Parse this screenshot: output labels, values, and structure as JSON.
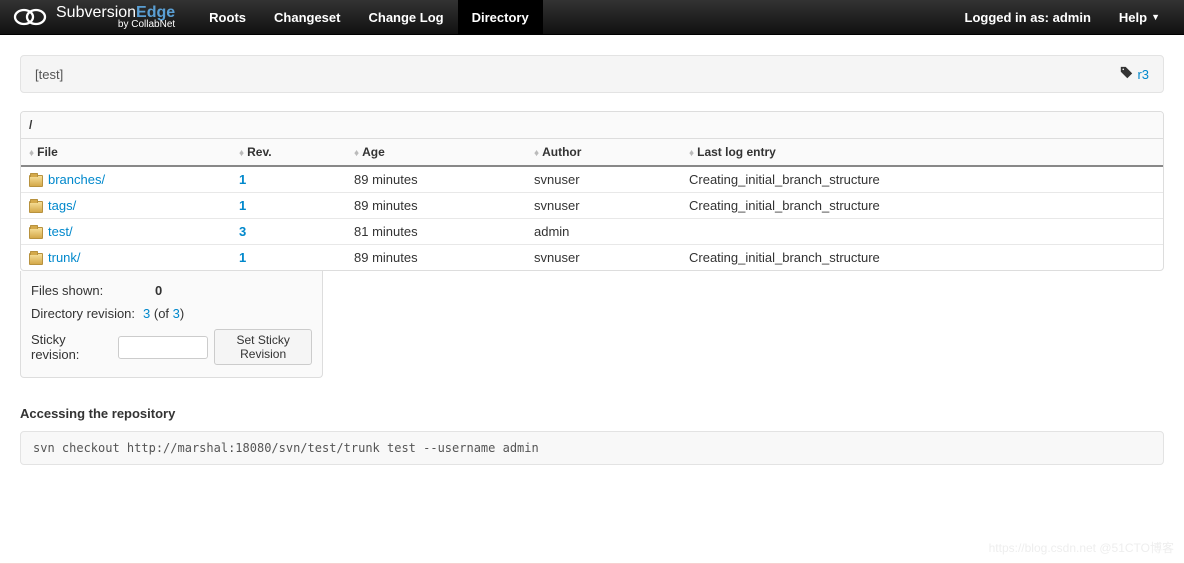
{
  "brand": {
    "subversion": "Subversion",
    "edge": "Edge",
    "sub": "by CollabNet"
  },
  "nav": {
    "roots": "Roots",
    "changeset": "Changeset",
    "changelog": "Change Log",
    "directory": "Directory"
  },
  "nav_right": {
    "logged_in": "Logged in as: admin",
    "help": "Help"
  },
  "breadcrumb": {
    "path": "[test]",
    "rev": "r3"
  },
  "table": {
    "root_path": "/",
    "headers": {
      "file": "File",
      "rev": "Rev.",
      "age": "Age",
      "author": "Author",
      "log": "Last log entry"
    },
    "rows": [
      {
        "name": "branches/",
        "rev": "1",
        "age": "89 minutes",
        "author": "svnuser",
        "log": "Creating_initial_branch_structure"
      },
      {
        "name": "tags/",
        "rev": "1",
        "age": "89 minutes",
        "author": "svnuser",
        "log": "Creating_initial_branch_structure"
      },
      {
        "name": "test/",
        "rev": "3",
        "age": "81 minutes",
        "author": "admin",
        "log": ""
      },
      {
        "name": "trunk/",
        "rev": "1",
        "age": "89 minutes",
        "author": "svnuser",
        "log": "Creating_initial_branch_structure"
      }
    ]
  },
  "info": {
    "files_shown_label": "Files shown:",
    "files_shown_value": "0",
    "dir_rev_label": "Directory revision:",
    "dir_rev_value": "3",
    "dir_rev_of": " (of ",
    "dir_rev_total": "3",
    "dir_rev_close": ")",
    "sticky_label": "Sticky revision:",
    "sticky_button": "Set Sticky Revision"
  },
  "access": {
    "title": "Accessing the repository",
    "command": "svn checkout http://marshal:18080/svn/test/trunk test --username admin"
  },
  "watermark": "https://blog.csdn.net @51CTO博客"
}
